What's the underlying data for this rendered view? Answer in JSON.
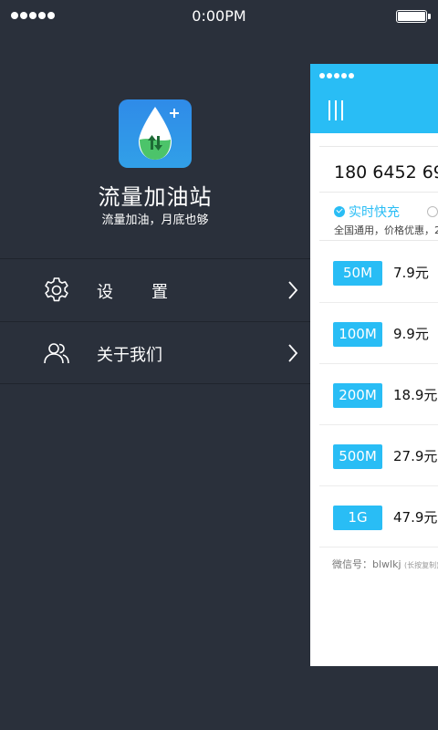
{
  "status_bar": {
    "time": "0:00PM"
  },
  "drawer": {
    "app_name": "流量加油站",
    "slogan": "流量加油，月底也够",
    "menu": [
      {
        "label": "设置",
        "icon": "gear-icon"
      },
      {
        "label": "关于我们",
        "icon": "users-icon"
      }
    ]
  },
  "main": {
    "phone_number": "180 6452 69",
    "option_selected": "实时快充",
    "description": "全国通用，价格优惠，2",
    "packages": [
      {
        "size": "50M",
        "price": "7.9元"
      },
      {
        "size": "100M",
        "price": "9.9元"
      },
      {
        "size": "200M",
        "price": "18.9元"
      },
      {
        "size": "500M",
        "price": "27.9元"
      },
      {
        "size": "1G",
        "price": "47.9元"
      }
    ],
    "wechat_label": "微信号：blwlkj",
    "wechat_hint": "(长按复制)"
  },
  "colors": {
    "drawer_bg": "#2a303b",
    "accent": "#29bdf5"
  }
}
